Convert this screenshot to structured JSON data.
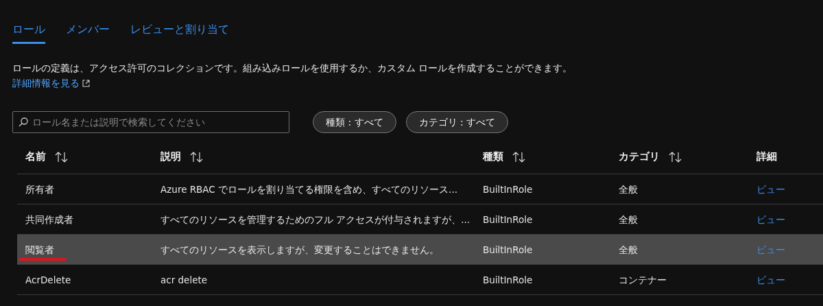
{
  "tabs": [
    {
      "label": "ロール",
      "selected": true
    },
    {
      "label": "メンバー",
      "selected": false
    },
    {
      "label": "レビューと割り当て",
      "selected": false
    }
  ],
  "intro": {
    "text": "ロールの定義は、アクセス許可のコレクションです。組み込みロールを使用するか、カスタム ロールを作成することができます。",
    "link": "詳細情報を見る"
  },
  "search": {
    "placeholder": "ロール名または説明で検索してください"
  },
  "filters": [
    "種類 : すべて",
    "カテゴリ : すべて"
  ],
  "table": {
    "columns": [
      {
        "label": "名前",
        "sortable": true
      },
      {
        "label": "説明",
        "sortable": true
      },
      {
        "label": "種類",
        "sortable": true
      },
      {
        "label": "カテゴリ",
        "sortable": true
      },
      {
        "label": "詳細",
        "sortable": false
      }
    ],
    "rows": [
      {
        "name": "所有者",
        "description": "Azure RBAC でロールを割り当てる権限を含め、すべてのリソース...",
        "type": "BuiltInRole",
        "category": "全般",
        "details": "ビュー",
        "selected": false,
        "underlined": false
      },
      {
        "name": "共同作成者",
        "description": "すべてのリソースを管理するためのフル アクセスが付与されますが、...",
        "type": "BuiltInRole",
        "category": "全般",
        "details": "ビュー",
        "selected": false,
        "underlined": false
      },
      {
        "name": "閲覧者",
        "description": "すべてのリソースを表示しますが、変更することはできません。",
        "type": "BuiltInRole",
        "category": "全般",
        "details": "ビュー",
        "selected": true,
        "underlined": true
      },
      {
        "name": "AcrDelete",
        "description": "acr delete",
        "type": "BuiltInRole",
        "category": "コンテナー",
        "details": "ビュー",
        "selected": false,
        "underlined": false
      }
    ]
  }
}
